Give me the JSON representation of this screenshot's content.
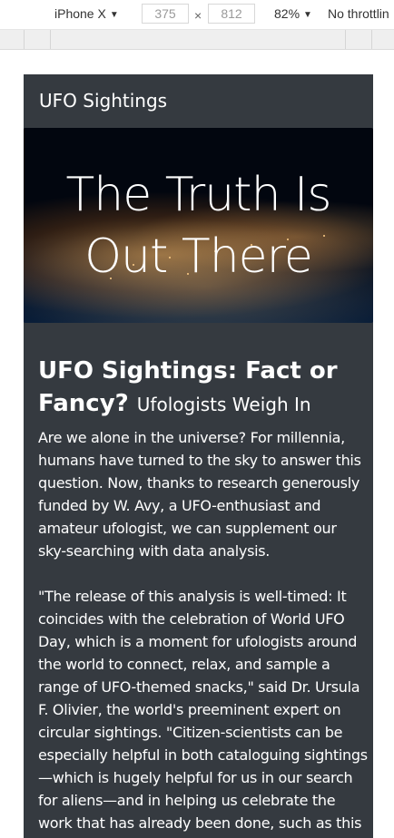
{
  "devtools": {
    "device": "iPhone X",
    "width": "375",
    "height": "812",
    "times": "×",
    "zoom": "82%",
    "throttle": "No throttlin",
    "caret": "▼"
  },
  "site": {
    "title": "UFO Sightings"
  },
  "hero": {
    "line1": "The Truth Is",
    "line2": "Out There"
  },
  "article": {
    "headline": "UFO Sightings: Fact or Fancy?",
    "subheadline": "Ufologists Weigh In",
    "paragraphs": [
      "Are we alone in the universe? For millennia, humans have turned to the sky to answer this question. Now, thanks to research generously funded by W. Avy, a UFO-enthusiast and amateur ufologist, we can supplement our sky-searching with data analysis.",
      "\"The release of this analysis is well-timed: It coincides with the celebration of World UFO Day, which is a moment for ufologists around the world to connect, relax, and sample a range of UFO-themed snacks,\" said Dr. Ursula F. Olivier, the world's preeminent expert on circular sightings. \"Citizen-scientists can be especially helpful in both cataloguing sightings—which is hugely helpful for us in our search for aliens—and in helping us celebrate the work that has already been done, such as this data"
    ]
  }
}
